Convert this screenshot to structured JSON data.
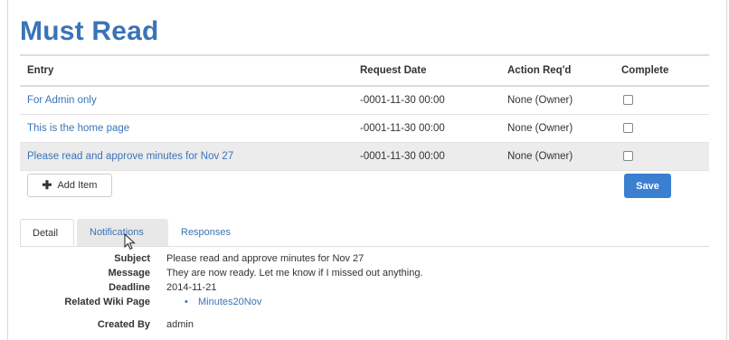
{
  "page": {
    "title": "Must Read"
  },
  "table": {
    "headers": {
      "entry": "Entry",
      "request_date": "Request Date",
      "action": "Action Req'd",
      "complete": "Complete"
    },
    "rows": [
      {
        "entry": "For Admin only",
        "request_date": "-0001-11-30 00:00",
        "action": "None (Owner)",
        "complete": false
      },
      {
        "entry": "This is the home page",
        "request_date": "-0001-11-30 00:00",
        "action": "None (Owner)",
        "complete": false
      },
      {
        "entry": "Please read and approve minutes for Nov 27",
        "request_date": "-0001-11-30 00:00",
        "action": "None (Owner)",
        "complete": false
      }
    ]
  },
  "buttons": {
    "add_item": "Add Item",
    "save": "Save"
  },
  "tabs": {
    "detail": "Detail",
    "notifications": "Notifications",
    "responses": "Responses"
  },
  "detail": {
    "subject_label": "Subject",
    "subject": "Please read and approve minutes for Nov 27",
    "message_label": "Message",
    "message": "They are now ready. Let me know if I missed out anything.",
    "deadline_label": "Deadline",
    "deadline": "2014-11-21",
    "wiki_label": "Related Wiki Page",
    "wiki_link": "Minutes20Nov",
    "created_by_label": "Created By",
    "created_by": "admin"
  },
  "colors": {
    "accent": "#3a73b8",
    "save_button": "#3a7fd0",
    "highlight_row": "#ececec"
  },
  "icons": {
    "add": "plus-icon",
    "cursor": "mouse-pointer-icon"
  }
}
